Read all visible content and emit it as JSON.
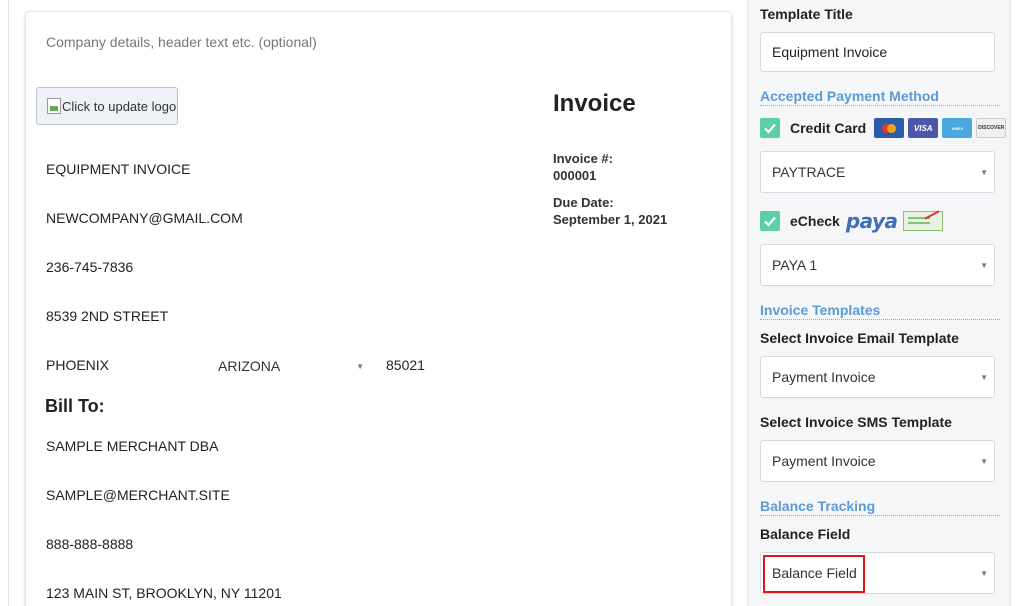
{
  "invoice": {
    "company_details_placeholder": "Company details, header text etc. (optional)",
    "logo_button_label": "Click to update logo",
    "title": "Invoice",
    "invoice_number_label": "Invoice #:",
    "invoice_number": "000001",
    "due_date_label": "Due Date:",
    "due_date": "September 1, 2021",
    "company": {
      "name": "EQUIPMENT INVOICE",
      "email": "NEWCOMPANY@GMAIL.COM",
      "phone": "236-745-7836",
      "street": "8539 2ND STREET",
      "city": "PHOENIX",
      "state": "ARIZONA",
      "zip": "85021"
    },
    "bill_to_label": "Bill To:",
    "bill_to": {
      "name": "SAMPLE MERCHANT DBA",
      "email": "SAMPLE@MERCHANT.SITE",
      "phone": "888-888-8888",
      "address": "123 MAIN ST, BROOKLYN, NY 11201"
    }
  },
  "panel": {
    "template_title_label": "Template Title",
    "template_title_value": "Equipment Invoice",
    "payment_section_heading": "Accepted Payment Method",
    "credit_card": {
      "label": "Credit Card",
      "checked": true,
      "card_logos": [
        {
          "name": "mastercard-logo",
          "text": "MasterCard"
        },
        {
          "name": "visa-logo",
          "text": "VISA"
        },
        {
          "name": "amex-logo",
          "text": "AMERICAN EXPRESS"
        },
        {
          "name": "discover-logo",
          "text": "DISCOVER"
        }
      ],
      "gateway_selected": "PAYTRACE"
    },
    "echeck": {
      "label": "eCheck",
      "checked": true,
      "logo_text": "paya",
      "gateway_selected": "PAYA 1"
    },
    "templates_section_heading": "Invoice Templates",
    "email_template_label": "Select Invoice Email Template",
    "email_template_selected": "Payment Invoice",
    "sms_template_label": "Select Invoice SMS Template",
    "sms_template_selected": "Payment Invoice",
    "balance_section_heading": "Balance Tracking",
    "balance_field_label": "Balance Field",
    "balance_field_selected": "Balance Field"
  },
  "colors": {
    "accent_blue": "#5b9bd5",
    "checkbox_green": "#5ccfa7",
    "highlight_red": "#e0141b"
  }
}
